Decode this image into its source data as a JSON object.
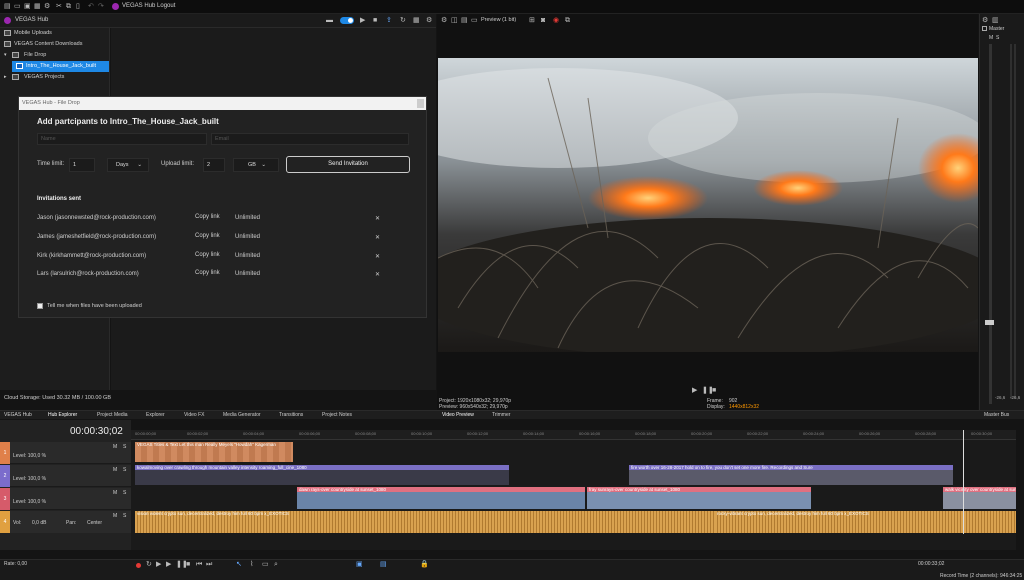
{
  "app": {
    "title": "VEGAS Hub Logout"
  },
  "hub": {
    "header_title": "VEGAS Hub",
    "tree": [
      {
        "label": "Mobile Uploads"
      },
      {
        "label": "VEGAS Content Downloads"
      },
      {
        "label": "File Drop"
      },
      {
        "label": "Intro_The_House_Jack_built"
      },
      {
        "label": "VEGAS Projects"
      }
    ],
    "cloud_storage": "Cloud Storage: Used 30.32 MB / 100.00 GB"
  },
  "dialog": {
    "window_title": "VEGAS Hub - File Drop",
    "heading": "Add partcipants to Intro_The_House_Jack_built",
    "name_placeholder": "Name",
    "email_placeholder": "Email",
    "time_limit_label": "Time limit:",
    "time_limit_value": "1",
    "time_unit": "Days",
    "upload_limit_label": "Upload limit:",
    "upload_limit_value": "2",
    "upload_unit": "GB",
    "send_button": "Send Invitation",
    "invitations_heading": "Invitations sent",
    "invitations": [
      {
        "name": "Jason (jasonnewsted@rock-production.com)",
        "link": "Copy link",
        "limit": "Unlimited"
      },
      {
        "name": "James (jameshetfield@rock-production.com)",
        "link": "Copy link",
        "limit": "Unlimited"
      },
      {
        "name": "Kirk (kirkhammett@rock-production.com)",
        "link": "Copy link",
        "limit": "Unlimited"
      },
      {
        "name": "Lars (larsulrich@rock-production.com)",
        "link": "Copy link",
        "limit": "Unlimited"
      }
    ],
    "notify_label": "Tell me when files have been uploaded",
    "remove_glyph": "✕"
  },
  "preview": {
    "mode": "Preview (1 bit)",
    "project": "Project:   1920x1080x32; 29,970p",
    "preview_res": "Preview:  960x540x32; 29,970p",
    "frame_label": "Frame:",
    "frame_value": "902",
    "display_label": "Display:",
    "display_value": "1440x812x32"
  },
  "meter": {
    "master": "Master",
    "m": "M",
    "s": "S",
    "left_level": "-26,6",
    "right_level": "-26,6",
    "fader_value": "0.0"
  },
  "tabs": [
    "VEGAS Hub",
    "Hub Explorer",
    "Project Media",
    "Explorer",
    "Video FX",
    "Media Generator",
    "Transitions",
    "Project Notes",
    "Video Preview",
    "Trimmer",
    "Master Bus"
  ],
  "timeline": {
    "timecode": "00:00:30;02",
    "ruler": [
      "00:00:00;00",
      "00:00:02;00",
      "00:00:04;00",
      "00:00:06;00",
      "00:00:08;00",
      "00:00:10;00",
      "00:00:12;00",
      "00:00:14;00",
      "00:00:16;00",
      "00:00:18;00",
      "00:00:20;00",
      "00:00:22;00",
      "00:00:24;00",
      "00:00:26;00",
      "00:00:28;00",
      "00:00:30;00",
      "00:00:32;00",
      "00:00:34;00"
    ],
    "tracks": [
      {
        "num": "1",
        "level": "Level: 100,0 %"
      },
      {
        "num": "2",
        "level": "Level: 100,0 %"
      },
      {
        "num": "3",
        "level": "Level: 100,0 %"
      },
      {
        "num": "4",
        "vol": "Vol:",
        "vol_value": "0,0 dB",
        "pan": "Pan:",
        "pan_value": "Center"
      }
    ],
    "clips": [
      "VEGAS Titles & Text Let this man Really Meyels \"Howdah\" Kagerman",
      "kowalmoving over crawling through mountain valley  intensity roaming_full_cine_1080",
      "fire worth over 16-28-2017 hold on to fire, you don't set one more fire. Recordings and Sure",
      "dawn rays-over countryside at sunset_1080",
      "fray sunrays-over countryside at sunset_1080",
      "walk vicinity over countryside at sunset_1080",
      "vision violent crypto sun, decentralized, destroy him full 60 bpm  x_EXOTICS",
      "rocky-vibrant crypto sun, decentralized, destroy him full 60 bpm x_EXOTICS"
    ],
    "end_time": "00:00:33;02"
  },
  "bottom": {
    "rate": "Rate: 0,00",
    "record_time": "Record Time (2 channels): 946:34:25"
  }
}
